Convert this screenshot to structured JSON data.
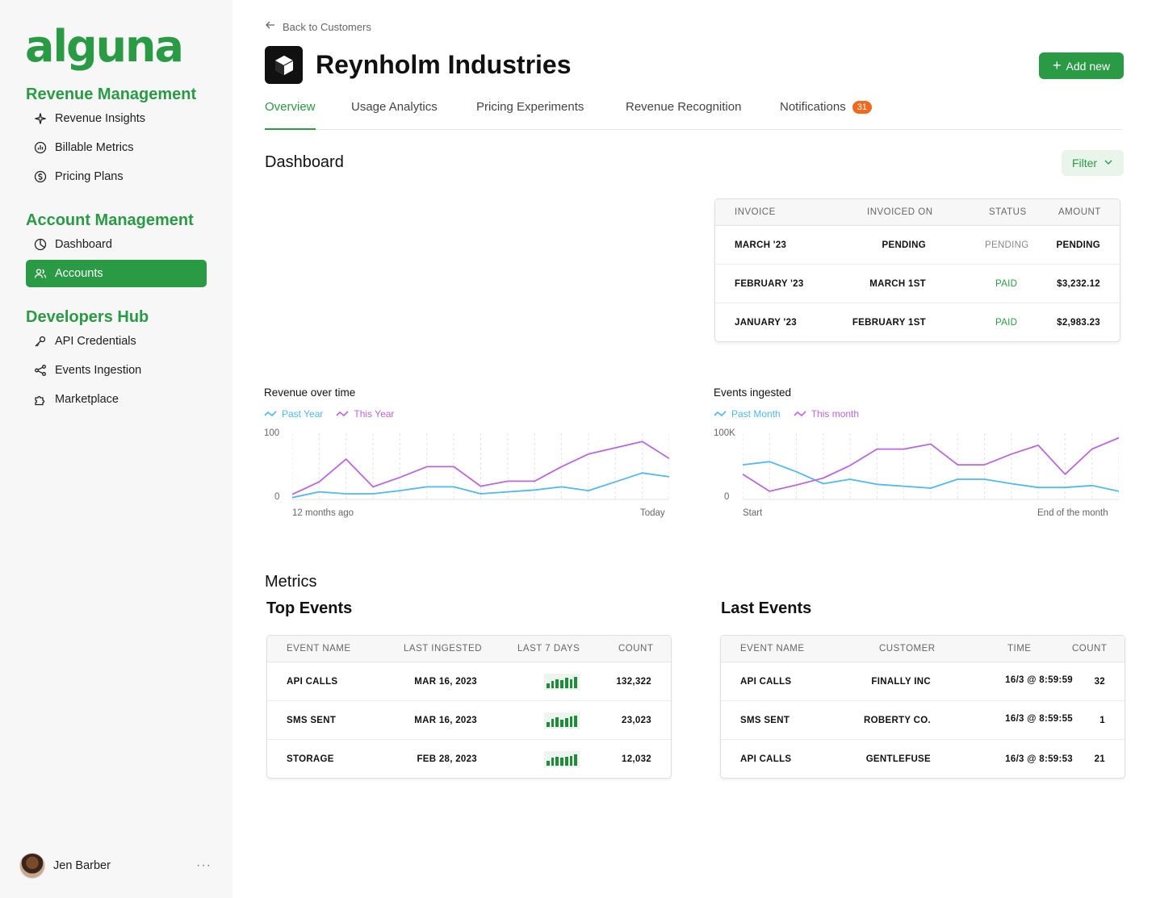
{
  "sidebar": {
    "logo": "alguna",
    "sections": [
      {
        "title": "Revenue Management",
        "items": [
          {
            "label": "Revenue Insights",
            "icon": "sparkle-icon"
          },
          {
            "label": "Billable Metrics",
            "icon": "chart-circle-icon"
          },
          {
            "label": "Pricing Plans",
            "icon": "dollar-circle-icon"
          }
        ]
      },
      {
        "title": "Account Management",
        "items": [
          {
            "label": "Dashboard",
            "icon": "pie-icon"
          },
          {
            "label": "Accounts",
            "icon": "users-icon",
            "active": true
          }
        ]
      },
      {
        "title": "Developers Hub",
        "items": [
          {
            "label": "API Credentials",
            "icon": "key-icon"
          },
          {
            "label": "Events Ingestion",
            "icon": "share-nodes-icon"
          },
          {
            "label": "Marketplace",
            "icon": "puzzle-icon"
          }
        ]
      }
    ],
    "user": {
      "name": "Jen Barber",
      "more": "···"
    }
  },
  "header": {
    "back_label": "Back to Customers",
    "company_name": "Reynholm Industries",
    "add_new_label": "Add new"
  },
  "tabs": [
    {
      "label": "Overview",
      "active": true
    },
    {
      "label": "Usage Analytics"
    },
    {
      "label": "Pricing Experiments"
    },
    {
      "label": "Revenue Recognition"
    },
    {
      "label": "Notifications",
      "badge": "31"
    }
  ],
  "dashboard": {
    "title": "Dashboard",
    "filter_label": "Filter",
    "invoices": {
      "columns": [
        "INVOICE",
        "INVOICED ON",
        "STATUS",
        "AMOUNT"
      ],
      "rows": [
        {
          "invoice": "MARCH '23",
          "invoiced_on": "PENDING",
          "status": "PENDING",
          "amount": "PENDING"
        },
        {
          "invoice": "FEBRUARY '23",
          "invoiced_on": "MARCH 1ST",
          "status": "PAID",
          "amount": "$3,232.12"
        },
        {
          "invoice": "JANUARY '23",
          "invoiced_on": "FEBRUARY 1ST",
          "status": "PAID",
          "amount": "$2,983.23"
        }
      ]
    }
  },
  "chart_data": [
    {
      "type": "line",
      "title": "Revenue over time",
      "x_start_label": "12 months ago",
      "x_end_label": "Today",
      "y_ticks": [
        "100",
        "0"
      ],
      "ylim": [
        0,
        100
      ],
      "grid": true,
      "legend_position": "top-left",
      "series": [
        {
          "name": "Past Year",
          "color": "#4fb8f5",
          "values": [
            3,
            12,
            9,
            9,
            14,
            20,
            20,
            9,
            12,
            15,
            20,
            14,
            28,
            42,
            36
          ]
        },
        {
          "name": "This Year",
          "color": "#b967dd",
          "values": [
            8,
            28,
            64,
            20,
            35,
            52,
            52,
            21,
            29,
            29,
            52,
            72,
            82,
            92,
            65
          ]
        }
      ]
    },
    {
      "type": "line",
      "title": "Events ingested",
      "x_start_label": "Start",
      "x_end_label": "End of the month",
      "y_ticks": [
        "100K",
        "0"
      ],
      "ylim": [
        0,
        100
      ],
      "grid": true,
      "legend_position": "top-left",
      "series": [
        {
          "name": "Past Month",
          "color": "#4fb8f5",
          "values": [
            55,
            60,
            44,
            25,
            32,
            24,
            21,
            18,
            32,
            32,
            25,
            19,
            19,
            22,
            13
          ]
        },
        {
          "name": "This month",
          "color": "#b967dd",
          "values": [
            40,
            13,
            23,
            34,
            54,
            80,
            80,
            88,
            55,
            55,
            72,
            86,
            40,
            80,
            98
          ]
        }
      ]
    }
  ],
  "metrics": {
    "title": "Metrics",
    "top_events": {
      "title": "Top Events",
      "columns": [
        "EVENT NAME",
        "LAST INGESTED",
        "LAST 7 DAYS",
        "COUNT"
      ],
      "rows": [
        {
          "name": "API CALLS",
          "last": "MAR 16, 2023",
          "count": "132,322",
          "spark": [
            35,
            55,
            70,
            60,
            80,
            70,
            85
          ]
        },
        {
          "name": "SMS SENT",
          "last": "MAR 16, 2023",
          "count": "23,023",
          "spark": [
            35,
            60,
            75,
            55,
            70,
            80,
            90
          ]
        },
        {
          "name": "STORAGE",
          "last": "FEB 28, 2023",
          "count": "12,032",
          "spark": [
            40,
            60,
            70,
            60,
            70,
            75,
            85
          ]
        }
      ]
    },
    "last_events": {
      "title": "Last Events",
      "columns": [
        "EVENT NAME",
        "CUSTOMER",
        "TIME",
        "COUNT"
      ],
      "rows": [
        {
          "name": "API CALLS",
          "customer": "FINALLY INC",
          "time": "16/3 @ 8:59:59",
          "count": "32"
        },
        {
          "name": "SMS SENT",
          "customer": "ROBERTY CO.",
          "time": "16/3 @ 8:59:55",
          "count": "1"
        },
        {
          "name": "API CALLS",
          "customer": "GENTLEFUSE",
          "time": "16/3 @ 8:59:53",
          "count": "21"
        }
      ]
    }
  },
  "colors": {
    "brand": "#2a9a45",
    "brand_light": "#e9f4ea",
    "badge": "#ef6a1f",
    "series_past": "#4fb8f5",
    "series_current": "#b967dd"
  }
}
